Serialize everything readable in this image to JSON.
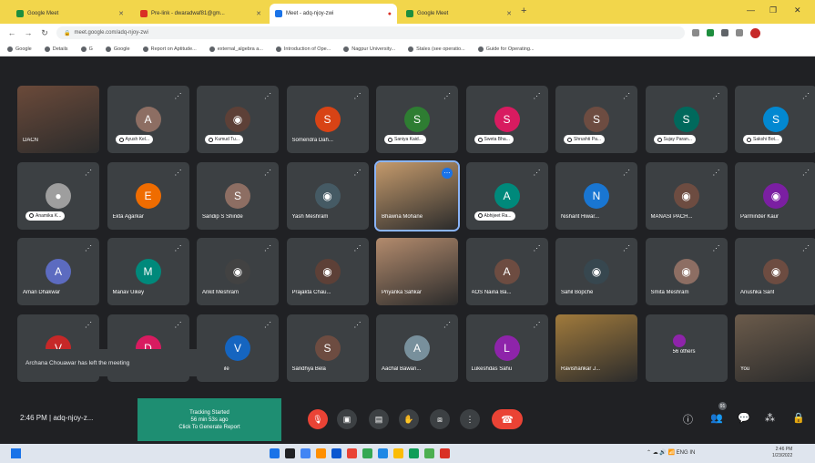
{
  "browser": {
    "tabs": [
      {
        "title": "Google Meet",
        "favicon_color": "#1e8e3e",
        "active": false
      },
      {
        "title": "Pre-link - dwaradwaf81@gm...",
        "favicon_color": "#d93025",
        "active": false
      },
      {
        "title": "Meet - adq-njoy-zwi",
        "favicon_color": "#1a73e8",
        "active": true
      },
      {
        "title": "Google Meet",
        "favicon_color": "#1e8e3e",
        "active": false
      }
    ],
    "url": "meet.google.com/adq-njoy-zwi",
    "bookmarks": [
      "Google",
      "Details",
      "G",
      "Google",
      "Report on Aptitude...",
      "external_algebra a...",
      "Introduction of Ope...",
      "Nagpur University...",
      "Stales (see operatio...",
      "Guide for Operating..."
    ]
  },
  "meeting": {
    "participants": [
      {
        "name": "DACN",
        "type": "video",
        "label_style": "name",
        "color": "#6b4a3a"
      },
      {
        "name": "Ayush Kel...",
        "initial": "A",
        "color": "#8d6e63",
        "label_style": "pill"
      },
      {
        "name": "Kumud Tu...",
        "type": "photo",
        "color": "#5d4037",
        "label_style": "pill"
      },
      {
        "name": "Somendra Dah...",
        "initial": "S",
        "color": "#d84315",
        "label_style": "name"
      },
      {
        "name": "Saniya Kaid...",
        "initial": "S",
        "color": "#2e7d32",
        "label_style": "pill"
      },
      {
        "name": "Sweta Bha...",
        "initial": "S",
        "color": "#d81b60",
        "label_style": "pill"
      },
      {
        "name": "Shrushti Pa...",
        "initial": "S",
        "color": "#6d4c41",
        "label_style": "pill"
      },
      {
        "name": "Sujay Paran...",
        "initial": "S",
        "color": "#00695c",
        "label_style": "pill"
      },
      {
        "name": "Sakshi Bot...",
        "initial": "S",
        "color": "#0288d1",
        "label_style": "pill"
      },
      {
        "name": "Anamika K...",
        "type": "default",
        "color": "#9e9e9e",
        "label_style": "pill"
      },
      {
        "name": "Ekta Agarkar",
        "initial": "E",
        "color": "#ef6c00",
        "label_style": "name"
      },
      {
        "name": "Sandip S Shinde",
        "initial": "S",
        "color": "#8d6e63",
        "label_style": "name"
      },
      {
        "name": "Yash Meshram",
        "type": "photo",
        "color": "#455a64",
        "label_style": "name"
      },
      {
        "name": "Bhawna Mohane",
        "type": "video",
        "color": "#c49a6c",
        "label_style": "name",
        "speaking": true
      },
      {
        "name": "Abhijeet Ra...",
        "initial": "A",
        "color": "#00897b",
        "label_style": "pill"
      },
      {
        "name": "Nishant Hiwar...",
        "initial": "N",
        "color": "#1976d2",
        "label_style": "name"
      },
      {
        "name": "MANASI PACH...",
        "type": "photo",
        "color": "#6d4c41",
        "label_style": "name"
      },
      {
        "name": "Parminder Kaur",
        "type": "photo",
        "color": "#7b1fa2",
        "label_style": "name"
      },
      {
        "name": "Aman Dhakwar",
        "initial": "A",
        "color": "#5c6bc0",
        "label_style": "name"
      },
      {
        "name": "Manav Uikey",
        "initial": "M",
        "color": "#00897b",
        "label_style": "name"
      },
      {
        "name": "Ankit Meshram",
        "type": "photo",
        "color": "#424242",
        "label_style": "name"
      },
      {
        "name": "Prajakta Chau...",
        "type": "photo",
        "color": "#5d4037",
        "label_style": "name"
      },
      {
        "name": "Priyanka Sahkar",
        "type": "video",
        "color": "#b38b6d",
        "label_style": "name"
      },
      {
        "name": "AOS Naina Ba...",
        "initial": "A",
        "color": "#6d4c41",
        "label_style": "name"
      },
      {
        "name": "Sahil Bopche",
        "type": "photo",
        "color": "#37474f",
        "label_style": "name"
      },
      {
        "name": "Smita Meshram",
        "type": "photo",
        "color": "#8d6e63",
        "label_style": "name"
      },
      {
        "name": "Anushka Sant",
        "type": "photo",
        "color": "#6d4c41",
        "label_style": "name"
      },
      {
        "name": "",
        "initial": "V",
        "color": "#c62828",
        "label_style": "name"
      },
      {
        "name": "",
        "initial": "D",
        "color": "#d81b60",
        "label_style": "name"
      },
      {
        "name": "...ali Kamle",
        "initial": "V",
        "color": "#1565c0",
        "label_style": "name"
      },
      {
        "name": "Sandhya Bela",
        "initial": "S",
        "color": "#6d4c41",
        "label_style": "name"
      },
      {
        "name": "Aachal Bawan...",
        "initial": "A",
        "color": "#78909c",
        "label_style": "name"
      },
      {
        "name": "Lukeshdas Sahu",
        "initial": "L",
        "color": "#8e24aa",
        "label_style": "name"
      },
      {
        "name": "Ravishankar J...",
        "type": "video",
        "color": "#a07a3c",
        "label_style": "name"
      },
      {
        "name": "56 others",
        "type": "others",
        "color": "#8e24aa",
        "label_style": "name"
      },
      {
        "name": "You",
        "type": "video",
        "color": "#6b5b4b",
        "label_style": "name"
      }
    ],
    "toast": "Archana Chouawar has left the meeting"
  },
  "controls": {
    "time": "2:46 PM",
    "separator": "|",
    "meeting_code": "adq-njoy-z...",
    "tracking": {
      "line1": "Tracking Started",
      "line2": "56 min 53s ago",
      "line3": "Click To Generate Report"
    },
    "people_count": "91"
  },
  "taskbar": {
    "apps_colors": [
      "#1a73e8",
      "#202124",
      "#4285f4",
      "#ff8f00",
      "#0b57d0",
      "#ea4335",
      "#34a853",
      "#1e88e5",
      "#fbbc04",
      "#0f9d58",
      "#4caf50",
      "#d93025"
    ],
    "tray": "ENG IN",
    "time": "2:46 PM",
    "date": "1/23/2022"
  }
}
